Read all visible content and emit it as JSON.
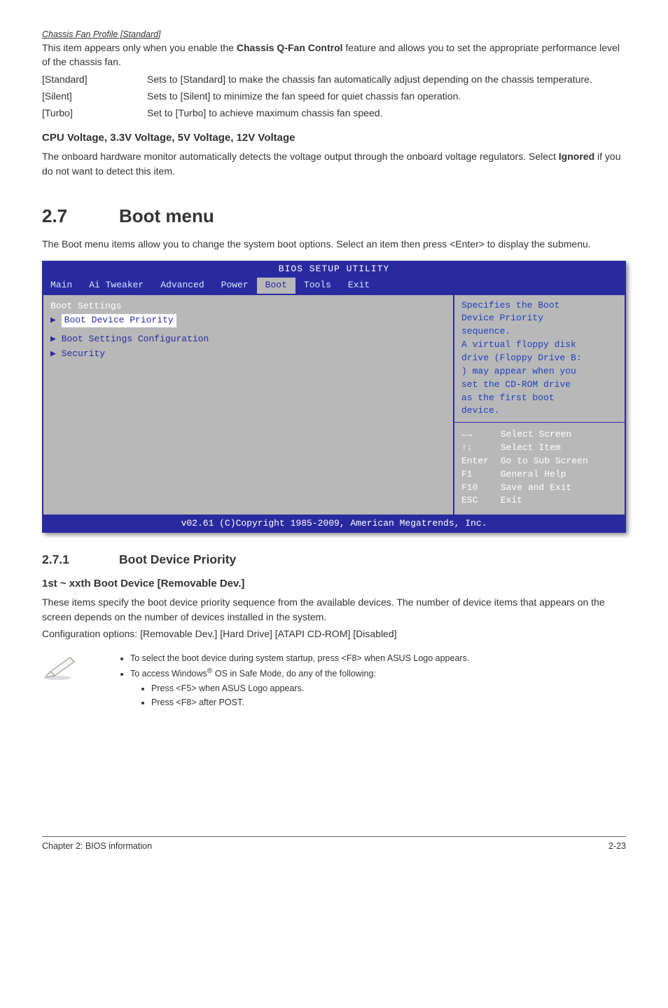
{
  "cfp": {
    "heading": "Chassis Fan Profile [Standard]",
    "intro_line1": "This item appears only when you enable the ",
    "intro_bold": "Chassis Q-Fan Control",
    "intro_line2": " feature and allows you to set the appropriate performance level of the chassis fan.",
    "options": [
      {
        "label": "[Standard]",
        "desc": "Sets to [Standard] to make the chassis fan automatically adjust depending on the chassis temperature."
      },
      {
        "label": "[Silent]",
        "desc": "Sets to [Silent] to minimize the fan speed for quiet chassis fan operation."
      },
      {
        "label": "[Turbo]",
        "desc": "Set to [Turbo] to achieve maximum chassis fan speed."
      }
    ]
  },
  "voltage": {
    "heading": "CPU Voltage, 3.3V Voltage, 5V Voltage, 12V Voltage",
    "body_pre": "The onboard hardware monitor automatically detects the voltage output through the onboard voltage regulators. Select ",
    "body_bold": "Ignored",
    "body_post": " if you do not want to detect this item."
  },
  "section27": {
    "num": "2.7",
    "title": "Boot menu",
    "body": "The Boot menu items allow you to change the system boot options. Select an item then press <Enter> to display the submenu."
  },
  "bios": {
    "title": "BIOS SETUP UTILITY",
    "tabs": [
      "Main",
      "Ai Tweaker",
      "Advanced",
      "Power",
      "Boot",
      "Tools",
      "Exit"
    ],
    "active_tab_index": 4,
    "left": {
      "heading": "Boot Settings",
      "items": [
        "Boot Device Priority",
        "Boot Settings Configuration",
        "Security"
      ]
    },
    "right_top": [
      "Specifies the Boot",
      "Device Priority",
      "sequence.",
      "",
      "A virtual floppy disk",
      "drive (Floppy Drive B:",
      ") may appear when you",
      "set the CD-ROM drive",
      "as the first boot",
      "device."
    ],
    "right_bottom": [
      {
        "k": "←→",
        "v": "Select Screen"
      },
      {
        "k": "↑↓",
        "v": "Select Item"
      },
      {
        "k": "Enter",
        "v": "Go to Sub Screen"
      },
      {
        "k": "F1",
        "v": "General Help"
      },
      {
        "k": "F10",
        "v": "Save and Exit"
      },
      {
        "k": "ESC",
        "v": "Exit"
      }
    ],
    "footer": "v02.61 (C)Copyright 1985-2009, American Megatrends, Inc."
  },
  "section271": {
    "num": "2.7.1",
    "title": "Boot Device Priority",
    "subheading": "1st ~ xxth Boot Device [Removable Dev.]",
    "body1": "These items specify the boot device priority sequence from the available devices. The number of device items that appears on the screen depends on the number of devices installed in the system.",
    "body2": "Configuration options: [Removable Dev.] [Hard Drive] [ATAPI CD-ROM] [Disabled]"
  },
  "notes": {
    "b1": "To select the boot device during system startup, press <F8> when ASUS Logo appears.",
    "b2_pre": "To access Windows",
    "b2_sup": "®",
    "b2_post": " OS in Safe Mode, do any of the following:",
    "sub1": "Press <F5> when ASUS Logo appears.",
    "sub2": "Press <F8> after POST."
  },
  "footer": {
    "left": "Chapter 2: BIOS information",
    "right": "2-23"
  }
}
